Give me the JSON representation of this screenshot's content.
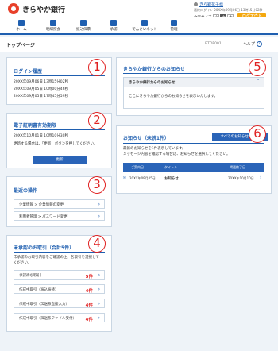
{
  "header": {
    "bank_name": "きらやか銀行",
    "user_label": "きら銀花子様",
    "last_login": "最終ログイン 20XX年09月06日 13時15分02秒",
    "font_size_label": "文字サイズ",
    "font_sizes": [
      "小",
      "中",
      "大"
    ],
    "logout": "ログアウト"
  },
  "nav": {
    "items": [
      {
        "label": "ホーム",
        "icon": "home-icon"
      },
      {
        "label": "明細照会",
        "icon": "document-icon"
      },
      {
        "label": "振込伝票",
        "icon": "transfer-icon"
      },
      {
        "label": "承認",
        "icon": "approval-icon"
      },
      {
        "label": "でんさいネット",
        "icon": "densai-icon"
      },
      {
        "label": "管理",
        "icon": "settings-icon"
      }
    ]
  },
  "page": {
    "title": "トップページ",
    "id": "BTOP001",
    "help": "ヘルプ",
    "help_icon": "?"
  },
  "login_history": {
    "title": "ログイン履歴",
    "badge": "1",
    "entries": [
      "20XX年09月06日 13時15分02秒",
      "20XX年09月05日 10時00分46秒",
      "20XX年09月05日 17時45分59秒"
    ]
  },
  "cert": {
    "title": "電子証明書有効期限",
    "badge": "2",
    "expiry": "20XX年10月01日 10時10分30秒",
    "note": "更新する場合は、「更新」ボタンを押してください。",
    "button": "更新"
  },
  "recent_ops": {
    "title": "最近の操作",
    "badge": "3",
    "items": [
      "企業情報 > 企業情報の変更",
      "利用者管理 > パスワード変更"
    ]
  },
  "unapproved": {
    "title": "未承認のお取引（合計5件）",
    "badge": "4",
    "note1": "未承認のお取引内容をご確認の上、各取引を選択して",
    "note2": "ください。",
    "items": [
      {
        "label": "承認待ち取引",
        "count": "5件"
      },
      {
        "label": "作成中取引（振込振替）",
        "count": "4件"
      },
      {
        "label": "作成中取引（伝送系直接入力）",
        "count": "4件"
      },
      {
        "label": "作成中取引（伝送系ファイル受付）",
        "count": "4件"
      }
    ]
  },
  "bank_notice": {
    "title": "きらやか銀行からのお知らせ",
    "badge": "5",
    "inner_title": "きらやか銀行からのお知らせ",
    "body": "ここにきらやか銀行からのお知らせを表示いたします。"
  },
  "notices": {
    "title": "お知らせ（未読1件）",
    "badge": "6",
    "all_button": "すべてのお知らせを表示",
    "note1": "最新のお知らせを1件表示しています。",
    "note2": "メッセージ内容を確認する場合は、お知らせを選択してください。",
    "columns": [
      "ご案内日",
      "タイトル",
      "掲載終了日"
    ],
    "rows": [
      {
        "date": "20XX年09月05日",
        "title": "お知らせ",
        "end": "20XX年10月10日"
      }
    ]
  },
  "colors": {
    "accent": "#1f5fb0",
    "badge": "#e02020",
    "logout": "#f4a80f"
  }
}
